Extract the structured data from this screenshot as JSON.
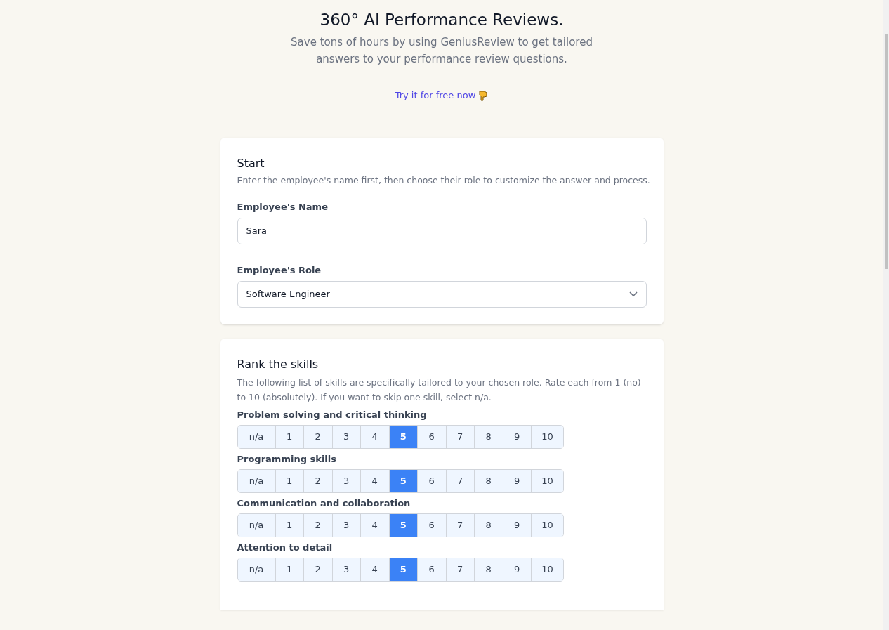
{
  "hero": {
    "title": "360° AI Performance Reviews.",
    "subtitle": "Save tons of hours by using GeniusReview to get tailored answers to your performance review questions.",
    "cta": "Try it for free now"
  },
  "start": {
    "title": "Start",
    "description": "Enter the employee's name first, then choose their role to customize the answer and process.",
    "name_label": "Employee's Name",
    "name_value": "Sara",
    "role_label": "Employee's Role",
    "role_value": "Software Engineer"
  },
  "skills": {
    "title": "Rank the skills",
    "description": "The following list of skills are specifically tailored to your chosen role. Rate each from 1 (no) to 10 (absolutely). If you want to skip one skill, select n/a.",
    "items": [
      {
        "name": "Problem solving and critical thinking",
        "options": [
          {
            "label": "n/a",
            "selected": false
          },
          {
            "label": "1",
            "selected": false
          },
          {
            "label": "2",
            "selected": false
          },
          {
            "label": "3",
            "selected": false
          },
          {
            "label": "4",
            "selected": false
          },
          {
            "label": "5",
            "selected": true
          },
          {
            "label": "6",
            "selected": false
          },
          {
            "label": "7",
            "selected": false
          },
          {
            "label": "8",
            "selected": false
          },
          {
            "label": "9",
            "selected": false
          },
          {
            "label": "10",
            "selected": false
          }
        ]
      },
      {
        "name": "Programming skills",
        "options": [
          {
            "label": "n/a",
            "selected": false
          },
          {
            "label": "1",
            "selected": false
          },
          {
            "label": "2",
            "selected": false
          },
          {
            "label": "3",
            "selected": false
          },
          {
            "label": "4",
            "selected": false
          },
          {
            "label": "5",
            "selected": true
          },
          {
            "label": "6",
            "selected": false
          },
          {
            "label": "7",
            "selected": false
          },
          {
            "label": "8",
            "selected": false
          },
          {
            "label": "9",
            "selected": false
          },
          {
            "label": "10",
            "selected": false
          }
        ]
      },
      {
        "name": "Communication and collaboration",
        "options": [
          {
            "label": "n/a",
            "selected": false
          },
          {
            "label": "1",
            "selected": false
          },
          {
            "label": "2",
            "selected": false
          },
          {
            "label": "3",
            "selected": false
          },
          {
            "label": "4",
            "selected": false
          },
          {
            "label": "5",
            "selected": true
          },
          {
            "label": "6",
            "selected": false
          },
          {
            "label": "7",
            "selected": false
          },
          {
            "label": "8",
            "selected": false
          },
          {
            "label": "9",
            "selected": false
          },
          {
            "label": "10",
            "selected": false
          }
        ]
      },
      {
        "name": "Attention to detail",
        "options": [
          {
            "label": "n/a",
            "selected": false
          },
          {
            "label": "1",
            "selected": false
          },
          {
            "label": "2",
            "selected": false
          },
          {
            "label": "3",
            "selected": false
          },
          {
            "label": "4",
            "selected": false
          },
          {
            "label": "5",
            "selected": true
          },
          {
            "label": "6",
            "selected": false
          },
          {
            "label": "7",
            "selected": false
          },
          {
            "label": "8",
            "selected": false
          },
          {
            "label": "9",
            "selected": false
          },
          {
            "label": "10",
            "selected": false
          }
        ]
      }
    ]
  }
}
